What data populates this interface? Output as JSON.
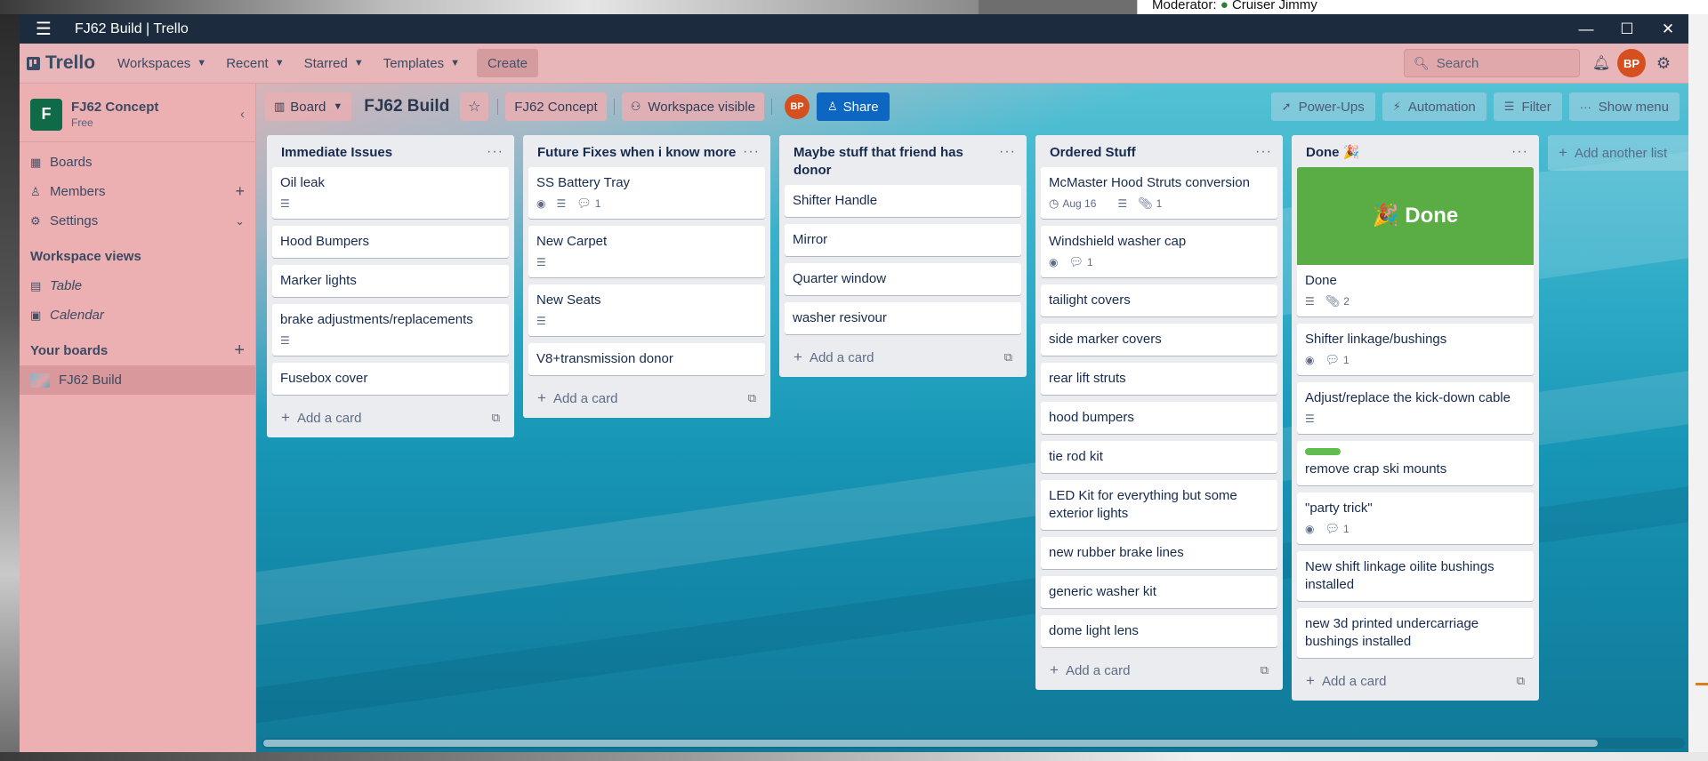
{
  "desktop": {
    "right_window_text": "Moderator:",
    "right_window_name": "Cruiser Jimmy"
  },
  "window": {
    "title": "FJ62 Build | Trello"
  },
  "topnav": {
    "logo": "Trello",
    "workspaces": "Workspaces",
    "recent": "Recent",
    "starred": "Starred",
    "templates": "Templates",
    "create": "Create",
    "search_placeholder": "Search",
    "avatar_initials": "BP"
  },
  "sidebar": {
    "workspace_initial": "F",
    "workspace_name": "FJ62 Concept",
    "workspace_plan": "Free",
    "items": [
      {
        "label": "Boards"
      },
      {
        "label": "Members"
      },
      {
        "label": "Settings"
      }
    ],
    "views_heading": "Workspace views",
    "views": [
      {
        "label": "Table"
      },
      {
        "label": "Calendar"
      }
    ],
    "your_boards_heading": "Your boards",
    "boards": [
      {
        "label": "FJ62 Build"
      }
    ]
  },
  "boardbar": {
    "view_label": "Board",
    "title": "FJ62 Build",
    "workspace_label": "FJ62 Concept",
    "visibility_label": "Workspace visible",
    "member_initials": "BP",
    "share_label": "Share",
    "powerups_label": "Power-Ups",
    "automation_label": "Automation",
    "filter_label": "Filter",
    "show_menu_label": "Show menu"
  },
  "lists": [
    {
      "title": "Immediate Issues",
      "cards": [
        {
          "title": "Oil leak",
          "desc": true
        },
        {
          "title": "Hood Bumpers"
        },
        {
          "title": "Marker lights"
        },
        {
          "title": "brake adjustments/replacements",
          "desc": true
        },
        {
          "title": "Fusebox cover"
        }
      ],
      "add_label": "Add a card"
    },
    {
      "title": "Future Fixes when i know more",
      "cards": [
        {
          "title": "SS Battery Tray",
          "watch": true,
          "desc": true,
          "comments": "1"
        },
        {
          "title": "New Carpet",
          "desc": true
        },
        {
          "title": "New Seats",
          "desc": true
        },
        {
          "title": "V8+transmission donor"
        }
      ],
      "add_label": "Add a card"
    },
    {
      "title": "Maybe stuff that friend has donor",
      "cards": [
        {
          "title": "Shifter Handle"
        },
        {
          "title": "Mirror"
        },
        {
          "title": "Quarter window"
        },
        {
          "title": "washer resivour"
        }
      ],
      "add_label": "Add a card"
    },
    {
      "title": "Ordered Stuff",
      "cards": [
        {
          "title": "McMaster Hood Struts conversion",
          "date": "Aug 16",
          "desc": true,
          "attachments": "1"
        },
        {
          "title": "Windshield washer cap",
          "watch": true,
          "comments": "1"
        },
        {
          "title": "tailight covers"
        },
        {
          "title": "side marker covers"
        },
        {
          "title": "rear lift struts"
        },
        {
          "title": "hood bumpers"
        },
        {
          "title": "tie rod kit"
        },
        {
          "title": "LED Kit for everything but some exterior lights"
        },
        {
          "title": "new rubber brake lines"
        },
        {
          "title": "generic washer kit"
        },
        {
          "title": "dome light lens"
        }
      ],
      "add_label": "Add a card"
    },
    {
      "title": "Done 🎉",
      "cover_text": "🎉 Done",
      "cards": [
        {
          "title": "Done",
          "desc": true,
          "attachments": "2"
        },
        {
          "title": "Shifter linkage/bushings",
          "watch": true,
          "comments": "1"
        },
        {
          "title": "Adjust/replace the kick-down cable",
          "desc": true
        },
        {
          "title": "remove crap ski mounts",
          "label_green": true
        },
        {
          "title": "\"party trick\"",
          "watch": true,
          "comments": "1"
        },
        {
          "title": "New shift linkage oilite bushings installed"
        },
        {
          "title": "new 3d printed undercarriage bushings installed"
        }
      ],
      "add_label": "Add a card"
    }
  ],
  "add_list_label": "Add another list"
}
